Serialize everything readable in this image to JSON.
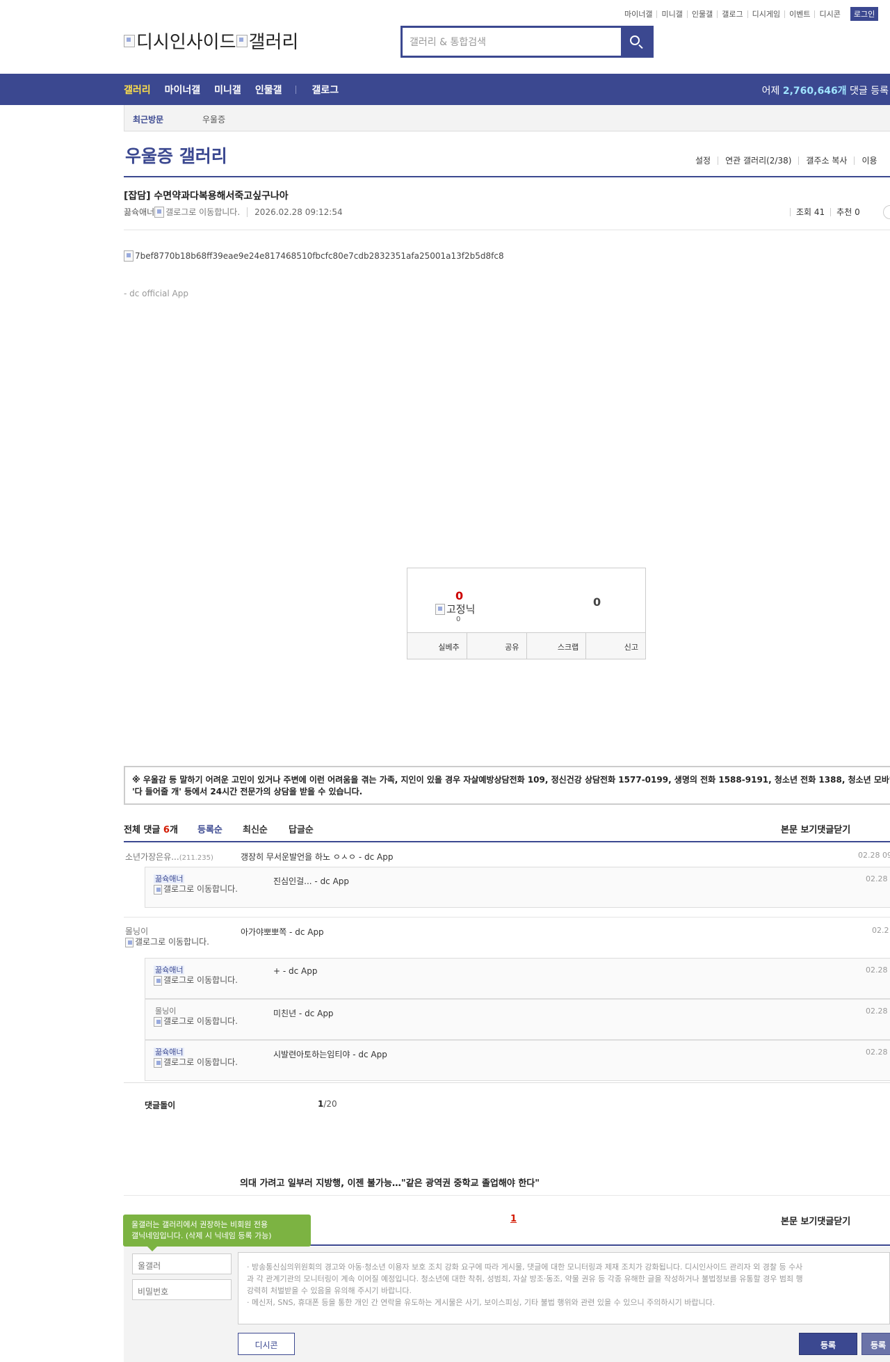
{
  "top_links": [
    "마이너갤",
    "미니갤",
    "인물갤",
    "갤로그",
    "디시게임",
    "이벤트",
    "디시콘"
  ],
  "login_label": "로그인",
  "logo": {
    "part1": "디시인사이드",
    "part2": "갤러리"
  },
  "search": {
    "placeholder": "갤러리 & 통합검색"
  },
  "nav": {
    "items": [
      "갤러리",
      "마이너갤",
      "미니갤",
      "인물갤",
      "갤로그"
    ],
    "yesterday_prefix": "어제 ",
    "yesterday_count": "2,760,646개",
    "yesterday_suffix": " 댓글 등록"
  },
  "recent": {
    "title": "최근방문",
    "gallery": "우울증"
  },
  "gallery": {
    "title": "우울증 갤러리",
    "tools": [
      "설정",
      "연관 갤러리(2/38)",
      "갤주소 복사",
      "이용"
    ]
  },
  "post": {
    "title": "[잡담] 수면약과다복용해서죽고싶구나아",
    "author": "끎슉애너",
    "gallog_alt": "갤로그로 이동합니다.",
    "date": "2026.02.28 09:12:54",
    "views": "조회 41",
    "recommends": "추천 0",
    "image_alt": "7bef8770b18b68ff39eae9e24e817468510fbcfc80e7cdb2832351afa25001a13f2b5d8fc8",
    "signature": "- dc official App"
  },
  "recommend": {
    "up_count": "0",
    "fixed_nick_alt": "고정닉",
    "fixed_count": "0",
    "down_count": "0",
    "buttons": [
      "실베추",
      "공유",
      "스크랩",
      "신고"
    ]
  },
  "notice": {
    "line1": "※ 우울감 등 말하기 어려운 고민이 있거나 주변에 이런 어려움을 겪는 가족, 지인이 있을 경우 자살예방상담전화 109, 정신건강 상담전화 1577-0199, 생명의 전화 1588-9191, 청소년 전화 1388, 청소년 모바일",
    "line2": "'다 들어줄 개' 등에서 24시간 전문가의 상담을 받을 수 있습니다."
  },
  "comments_header": {
    "total_prefix": "전체 댓글 ",
    "total_count": "6",
    "total_suffix": "개",
    "sorts": [
      "등록순",
      "최신순",
      "답글순"
    ],
    "right": [
      "본문 보기",
      "댓글닫기"
    ]
  },
  "comments": [
    {
      "nick": "소년가장은유...",
      "ip": "(211.235)",
      "text": "갱장히 무서운발언을 하노 ㅇㅅㅇ - dc App",
      "time": "02.28 09"
    },
    {
      "nick": "끎슉애너",
      "gallog": "갤로그로 이동합니다.",
      "text": "진심인걸... - dc App",
      "time": "02.28 0"
    },
    {
      "nick": "몰닝이",
      "gallog": "갤로그로 이동합니다.",
      "text": "아가야뽀뽀쪽 - dc App",
      "time": "02.2"
    },
    {
      "nick": "끎슉애너",
      "gallog": "갤로그로 이동합니다.",
      "text": "+ - dc App",
      "time": "02.28 0"
    },
    {
      "nick": "몰닝이",
      "gallog": "갤로그로 이동합니다.",
      "text": "미친년 - dc App",
      "time": "02.28 0"
    },
    {
      "nick": "끎슉애너",
      "gallog": "갤로그로 이동합니다.",
      "text": "시발련아토하는임티야 - dc App",
      "time": "02.28 0"
    }
  ],
  "comment_footer": {
    "label": "댓글돌이",
    "page_current": "1",
    "page_total": "/20"
  },
  "headline": "의대 가려고 일부러 지방행, 이젠 불가능…\"같은 광역권 중학교 졸업해야 한다\"",
  "pagination": {
    "current": "1"
  },
  "bottom_right": [
    "본문 보기",
    "댓글닫기"
  ],
  "tooltip": {
    "line1": "울갤러는 갤러리에서 권장하는 비회원 전용",
    "line2": "갤닉네임입니다. (삭제 시 닉네임 등록 가능)"
  },
  "write": {
    "nick_value": "울갤러",
    "password_placeholder": "비밀번호",
    "notice_lines": [
      "· 방송통신심의위원회의 경고와 아동·청소년 이용자 보호 조치 강화 요구에 따라 게시물, 댓글에 대한 모니터링과 제재 조치가 강화됩니다. 디시인사이드 관리자 외 경찰 등 수사",
      "과 각 관계기관의 모니터링이 계속 이어질 예정입니다. 청소년에 대한 착취, 성범죄, 자살 방조·동조, 약물 권유 등 각종 유해한 글을 작성하거나 불법정보를 유통할 경우 범죄 행",
      "강력히 처벌받을 수 있음을 유의해 주시기 바랍니다.",
      "· 메신저, SNS, 휴대폰 등을 통한 개인 간 연락을 유도하는 게시물은 사기, 보이스피싱, 기타 불법 행위와 관련 있을 수 있으니 주의하시기 바랍니다."
    ],
    "dccon_label": "디시콘",
    "submit_label": "등록",
    "submit2_label": "등록"
  },
  "colors": {
    "brand": "#3b4890",
    "accent_red": "#d31900",
    "nav_active": "#ffe04a",
    "tooltip_green": "#7cb342"
  }
}
